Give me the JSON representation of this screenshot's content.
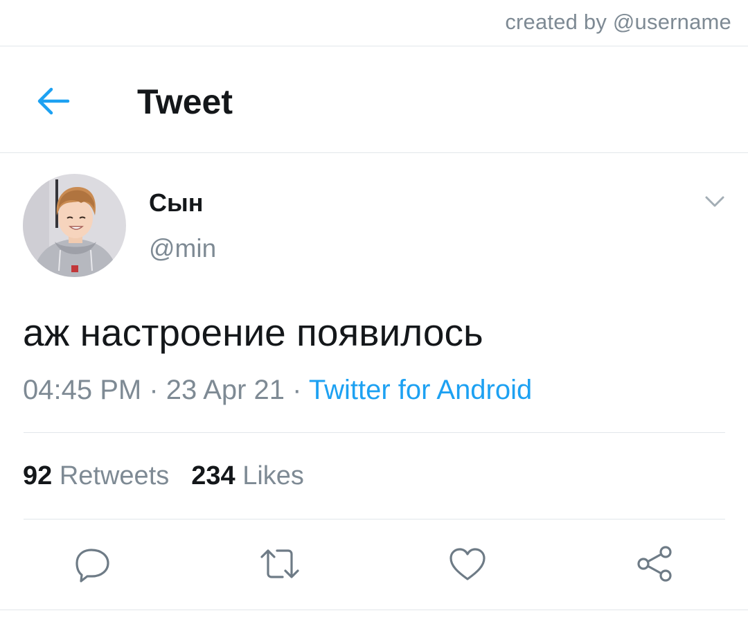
{
  "credit": "created by @username",
  "header": {
    "title": "Tweet"
  },
  "author": {
    "display_name": "Сын",
    "handle": "@min"
  },
  "tweet": {
    "text": "аж настроение появилось",
    "time": "04:45 PM",
    "date": "23 Apr 21",
    "separator": "·",
    "source": "Twitter for Android"
  },
  "stats": {
    "retweets_count": "92",
    "retweets_label": "Retweets",
    "likes_count": "234",
    "likes_label": "Likes"
  },
  "icons": {
    "back": "arrow-left-icon",
    "caret": "chevron-down-icon",
    "reply": "reply-icon",
    "retweet": "retweet-icon",
    "like": "heart-icon",
    "share": "share-icon"
  },
  "colors": {
    "accent": "#1da1f2",
    "text": "#14171a",
    "secondary": "#7e8a94",
    "divider": "#e1e6ea"
  }
}
